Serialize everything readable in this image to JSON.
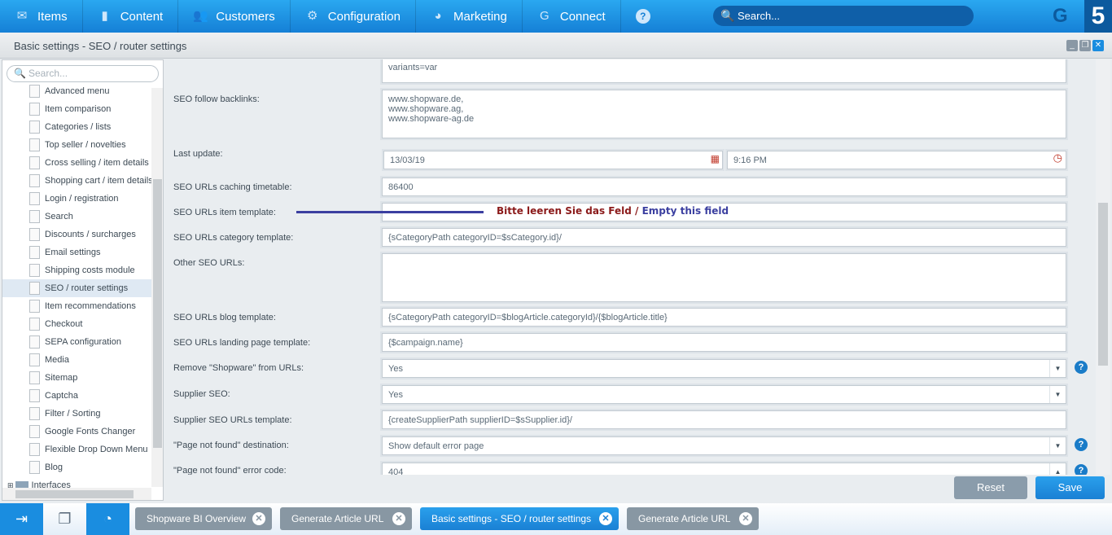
{
  "topnav": {
    "items": [
      {
        "label": "Items",
        "icon": "inbox-icon"
      },
      {
        "label": "Content",
        "icon": "document-icon"
      },
      {
        "label": "Customers",
        "icon": "users-icon"
      },
      {
        "label": "Configuration",
        "icon": "gear-icon"
      },
      {
        "label": "Marketing",
        "icon": "pie-chart-icon"
      },
      {
        "label": "Connect",
        "icon": "shopware-icon"
      }
    ],
    "help": "?",
    "search_placeholder": "Search...",
    "version": "5"
  },
  "window": {
    "title": "Basic settings - SEO / router settings"
  },
  "sidebar": {
    "search_placeholder": "Search...",
    "items": [
      "Advanced menu",
      "Item comparison",
      "Categories / lists",
      "Top seller / novelties",
      "Cross selling / item details",
      "Shopping cart / item details",
      "Login / registration",
      "Search",
      "Discounts / surcharges",
      "Email settings",
      "Shipping costs module",
      "SEO / router settings",
      "Item recommendations",
      "Checkout",
      "SEPA configuration",
      "Media",
      "Sitemap",
      "Captcha",
      "Filter / Sorting",
      "Google Fonts Changer",
      "Flexible Drop Down Menu",
      "Blog"
    ],
    "selected": "SEO / router settings",
    "folder": "Interfaces"
  },
  "form": {
    "prev_textarea": "variants=var",
    "backlinks": {
      "label": "SEO follow backlinks:",
      "value": "www.shopware.de,\nwww.shopware.ag,\nwww.shopware-ag.de"
    },
    "last_update": {
      "label": "Last update:",
      "date": "13/03/19",
      "time": "9:16 PM"
    },
    "caching": {
      "label": "SEO URLs caching timetable:",
      "value": "86400"
    },
    "item_template": {
      "label": "SEO URLs item template:",
      "value": ""
    },
    "category_template": {
      "label": "SEO URLs category template:",
      "value": "{sCategoryPath categoryID=$sCategory.id}/"
    },
    "other": {
      "label": "Other SEO URLs:",
      "value": ""
    },
    "blog_template": {
      "label": "SEO URLs blog template:",
      "value": "{sCategoryPath categoryID=$blogArticle.categoryId}/{$blogArticle.title}"
    },
    "landing_template": {
      "label": "SEO URLs landing page template:",
      "value": "{$campaign.name}"
    },
    "remove_shopware": {
      "label": "Remove \"Shopware\" from URLs:",
      "value": "Yes"
    },
    "supplier_seo": {
      "label": "Supplier SEO:",
      "value": "Yes"
    },
    "supplier_template": {
      "label": "Supplier SEO URLs template:",
      "value": "{createSupplierPath supplierID=$sSupplier.id}/"
    },
    "not_found_dest": {
      "label": "\"Page not found\" destination:",
      "value": "Show default error page"
    },
    "not_found_code": {
      "label": "\"Page not found\" error code:",
      "value": "404"
    }
  },
  "annotation": {
    "de": "Bitte leeren Sie das Feld / ",
    "en": "Empty this field",
    "color_de": "#8b1a1a",
    "color_en": "#3b3fa0"
  },
  "footer": {
    "reset": "Reset",
    "save": "Save"
  },
  "taskbar": {
    "tasks": [
      "Shopware BI Overview",
      "Generate Article URL",
      "Basic settings - SEO / router settings",
      "Generate Article URL"
    ],
    "active": "Basic settings - SEO / router settings"
  }
}
